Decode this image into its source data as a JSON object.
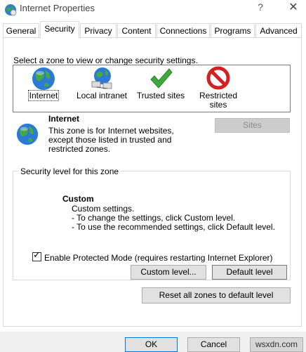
{
  "window": {
    "title": "Internet Properties",
    "help_glyph": "?",
    "close_glyph": "✕"
  },
  "tabs": [
    {
      "label": "General"
    },
    {
      "label": "Security"
    },
    {
      "label": "Privacy"
    },
    {
      "label": "Content"
    },
    {
      "label": "Connections"
    },
    {
      "label": "Programs"
    },
    {
      "label": "Advanced"
    }
  ],
  "zones": {
    "prompt": "Select a zone to view or change security settings.",
    "items": [
      {
        "label": "Internet",
        "icon": "globe-icon"
      },
      {
        "label": "Local intranet",
        "icon": "network-globe-icon"
      },
      {
        "label": "Trusted sites",
        "icon": "checkmark-icon"
      },
      {
        "label": "Restricted sites",
        "icon": "prohibited-icon"
      }
    ]
  },
  "zone_info": {
    "name": "Internet",
    "description": "This zone is for Internet websites, except those listed in trusted and restricted zones.",
    "sites_button": "Sites"
  },
  "security_level": {
    "legend": "Security level for this zone",
    "level_name": "Custom",
    "lines": [
      "Custom settings.",
      "- To change the settings, click Custom level.",
      "- To use the recommended settings, click Default level."
    ],
    "protected_mode_label": "Enable Protected Mode (requires restarting Internet Explorer)",
    "protected_mode_checked": true,
    "custom_level_button": "Custom level...",
    "default_level_button": "Default level"
  },
  "reset_button": "Reset all zones to default level",
  "footer": {
    "ok": "OK",
    "cancel": "Cancel",
    "watermark": "wsxdn.com"
  }
}
